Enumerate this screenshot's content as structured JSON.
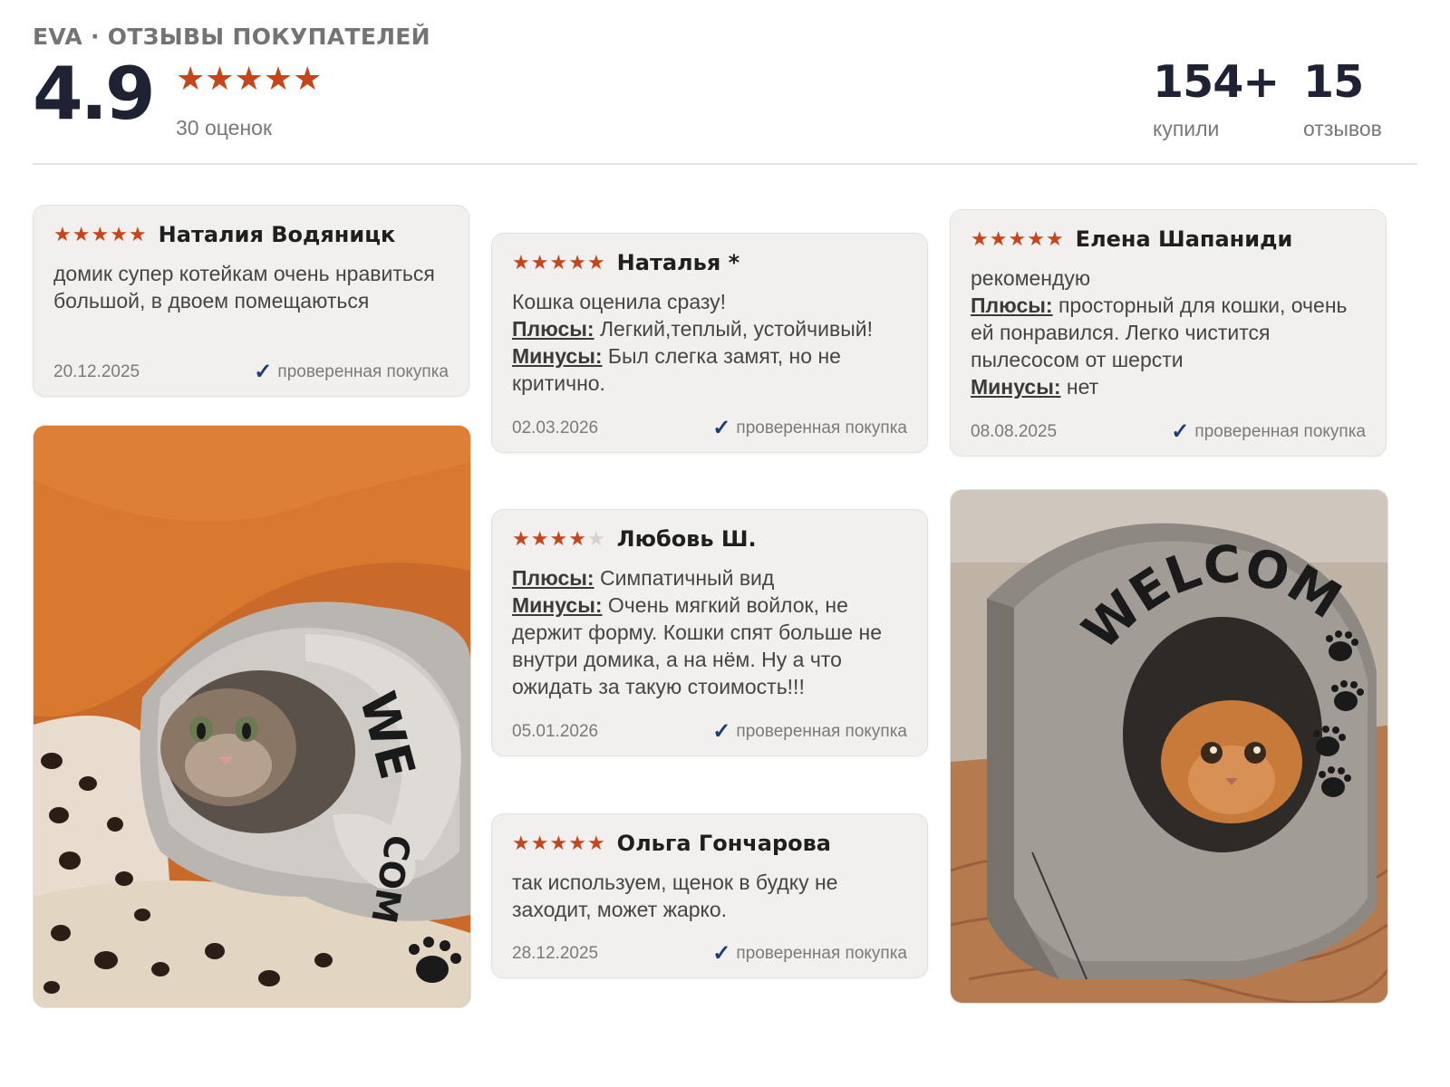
{
  "header": {
    "brand": "EVA · ОТЗЫВЫ ПОКУПАТЕЛЕЙ",
    "rating": "4.9",
    "rating_stars": 5,
    "rating_count": "30 оценок",
    "bought_num": "154+",
    "bought_label": "купили",
    "reviews_num": "15",
    "reviews_label": "отзывов"
  },
  "accent_color": "#c4461a",
  "reviews": [
    {
      "stars": 5,
      "author": "Наталия Водяницк",
      "text": "домик супер котейкам очень нравиться большой, в двоем помещаються",
      "pros": "",
      "cons": "",
      "date": "20.12.2025",
      "verified": "проверенная покупка"
    },
    {
      "stars": 5,
      "author": "Наталья *",
      "text": "Кошка оценила сразу!",
      "pros_label": "Плюсы:",
      "pros": " Легкий,теплый, устойчивый!",
      "cons_label": "Минусы:",
      "cons": " Был слегка замят, но не критично.",
      "date": "02.03.2026",
      "verified": "проверенная покупка"
    },
    {
      "stars": 5,
      "author": "Елена Шапаниди",
      "text": "рекомендую",
      "pros_label": "Плюсы:",
      "pros": " просторный для кошки, очень ей понравился. Легко чистится пылесосом от шерсти",
      "cons_label": "Минусы:",
      "cons": " нет",
      "date": "08.08.2025",
      "verified": "проверенная покупка"
    },
    {
      "stars": 4,
      "author": "Любовь Ш.",
      "pros_label": "Плюсы:",
      "pros": " Симпатичный вид",
      "cons_label": "Минусы:",
      "cons": " Очень мягкий войлок, не держит форму. Кошки спят больше не внутри домика, а на нём. Ну а что ожидать за такую стоимость!!!",
      "date": "05.01.2026",
      "verified": "проверенная покупка"
    },
    {
      "stars": 5,
      "author": "Ольга Гончарова",
      "text": "так используем, щенок в будку не заходит, может жарко.",
      "date": "28.12.2025",
      "verified": "проверенная покупка"
    }
  ],
  "photos": {
    "left_word": "WE",
    "left_word2": "COM",
    "right_word": "WELCOME"
  }
}
